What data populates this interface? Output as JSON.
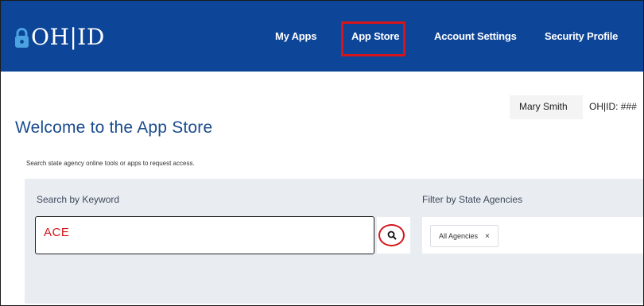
{
  "header": {
    "logo_text": "OH|ID",
    "nav": [
      "My Apps",
      "App Store",
      "Account Settings",
      "Security Profile"
    ],
    "active_nav": "App Store"
  },
  "user": {
    "name": "Mary Smith",
    "id_text": "OH|ID: ###"
  },
  "page": {
    "title": "Welcome to the App Store",
    "subtitle": "Search state agency online tools or apps to request access."
  },
  "search": {
    "keyword_label": "Search by Keyword",
    "keyword_value": "ACE",
    "filter_label": "Filter by State Agencies",
    "filter_chip": "All Agencies",
    "chip_remove": "×"
  },
  "colors": {
    "header_bg": "#0d4598",
    "highlight": "#d4151c",
    "title": "#1a4b8c",
    "panel_bg": "#e9ecf1"
  },
  "icons": [
    "lock-icon",
    "search-icon",
    "close-icon"
  ]
}
